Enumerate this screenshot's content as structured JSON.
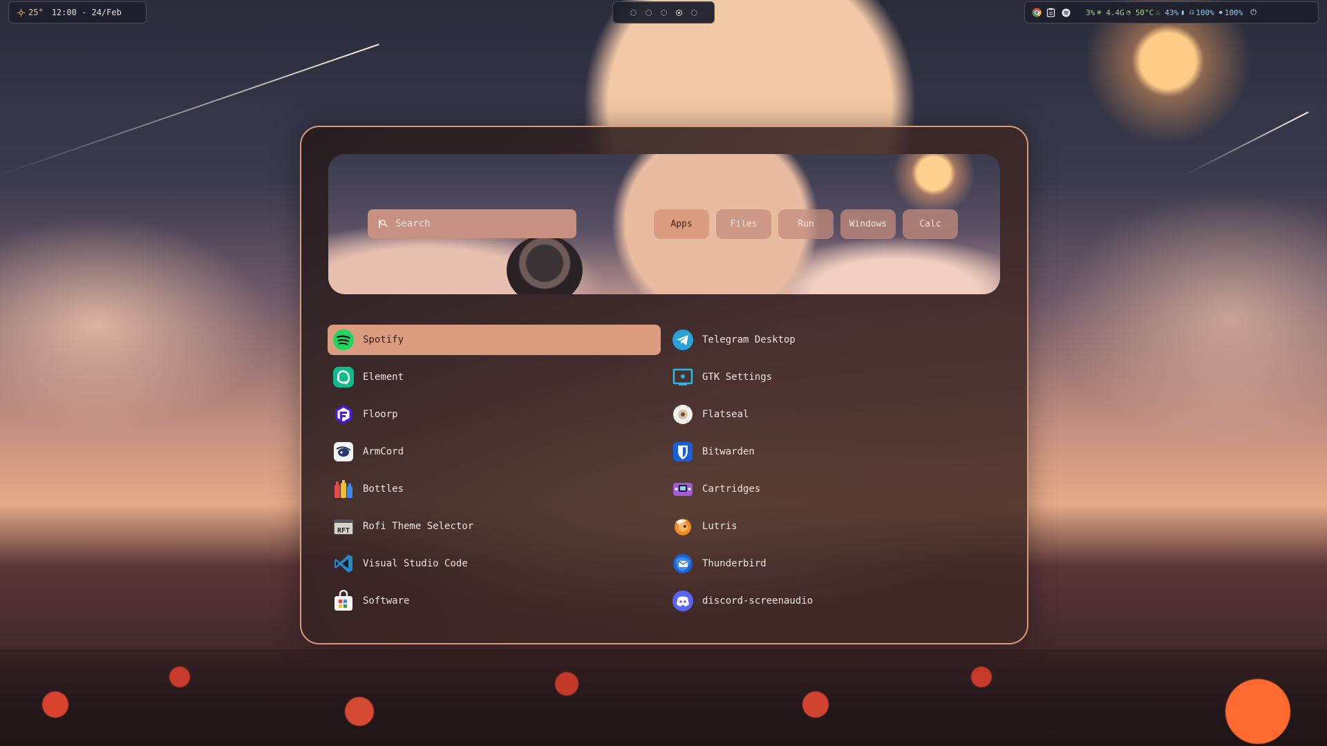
{
  "topbar": {
    "weather": "25°",
    "datetime": "12:00 - 24/Feb",
    "workspaces": [
      {
        "active": false
      },
      {
        "active": false
      },
      {
        "active": false
      },
      {
        "active": true
      },
      {
        "active": false
      }
    ],
    "status": {
      "cpu": "3%",
      "memory": "4.4G",
      "temperature": "50°C",
      "battery": "43%",
      "volume": "100%",
      "mic": "100%"
    },
    "tray_icons": [
      "chrome-icon",
      "clipboard-icon",
      "spotify-tray-icon"
    ]
  },
  "launcher": {
    "search": {
      "placeholder": "Search",
      "value": ""
    },
    "modes": [
      {
        "label": "Apps",
        "active": true
      },
      {
        "label": "Files",
        "active": false
      },
      {
        "label": "Run",
        "active": false
      },
      {
        "label": "Windows",
        "active": false
      },
      {
        "label": "Calc",
        "active": false
      }
    ],
    "apps_left": [
      {
        "label": "Spotify",
        "icon": "spotify-icon",
        "selected": true
      },
      {
        "label": "Element",
        "icon": "element-icon"
      },
      {
        "label": "Floorp",
        "icon": "floorp-icon"
      },
      {
        "label": "ArmCord",
        "icon": "armcord-icon"
      },
      {
        "label": "Bottles",
        "icon": "bottles-icon"
      },
      {
        "label": "Rofi Theme Selector",
        "icon": "rofi-theme-icon"
      },
      {
        "label": "Visual Studio Code",
        "icon": "vscode-icon"
      },
      {
        "label": "Software",
        "icon": "software-icon"
      }
    ],
    "apps_right": [
      {
        "label": "Telegram Desktop",
        "icon": "telegram-icon"
      },
      {
        "label": "GTK Settings",
        "icon": "gtk-settings-icon"
      },
      {
        "label": "Flatseal",
        "icon": "flatseal-icon"
      },
      {
        "label": "Bitwarden",
        "icon": "bitwarden-icon"
      },
      {
        "label": "Cartridges",
        "icon": "cartridges-icon"
      },
      {
        "label": "Lutris",
        "icon": "lutris-icon"
      },
      {
        "label": "Thunderbird",
        "icon": "thunderbird-icon"
      },
      {
        "label": "discord-screenaudio",
        "icon": "discord-icon"
      }
    ]
  },
  "colors": {
    "accent": "#dc9c80",
    "border": "#dc9c7c",
    "bar_bg": "#1e202c"
  }
}
